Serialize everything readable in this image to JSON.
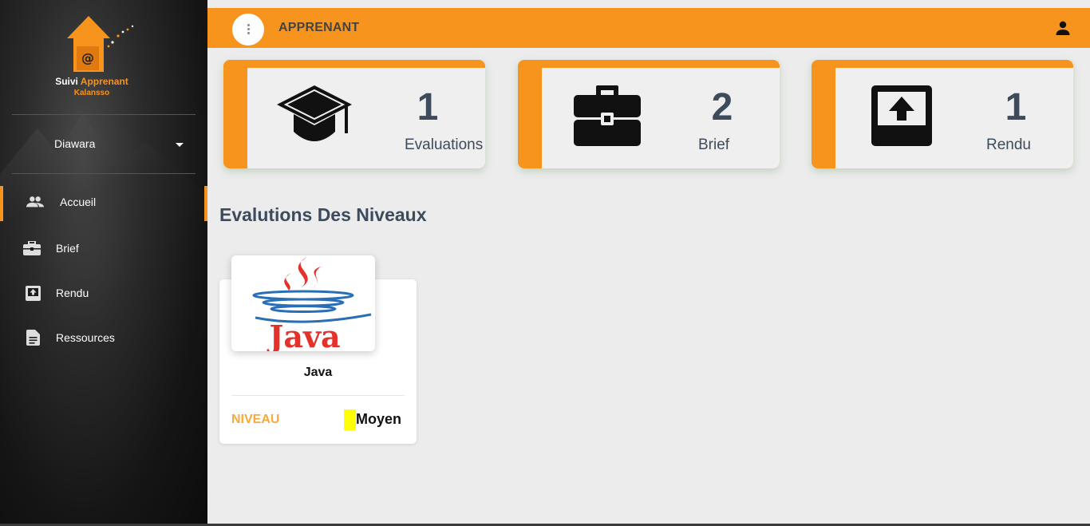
{
  "brand": {
    "name_part1": "Suivi ",
    "name_part2": "Apprenant",
    "subtitle": "Kalansso",
    "accent_color": "#f7941d"
  },
  "sidebar": {
    "user": "Diawara",
    "items": [
      {
        "label": "Accueil",
        "icon": "people-icon",
        "active": true
      },
      {
        "label": "Brief",
        "icon": "briefcase-icon",
        "active": false
      },
      {
        "label": "Rendu",
        "icon": "upload-box-icon",
        "active": false
      },
      {
        "label": "Ressources",
        "icon": "document-icon",
        "active": false
      }
    ]
  },
  "topbar": {
    "title": "APPRENANT",
    "menu_icon": "more-vertical-icon",
    "account_icon": "person-icon"
  },
  "stats": [
    {
      "value": "1",
      "label": "Evaluations",
      "icon": "graduation-cap-icon"
    },
    {
      "value": "2",
      "label": "Brief",
      "icon": "briefcase-icon"
    },
    {
      "value": "1",
      "label": "Rendu",
      "icon": "upload-box-icon"
    }
  ],
  "main": {
    "section_title": "Evalutions Des Niveaux",
    "courses": [
      {
        "name": "Java",
        "logo_text": "Java",
        "level_label": "NIVEAU",
        "level_value": "Moyen",
        "level_color": "#ffff00"
      }
    ]
  }
}
